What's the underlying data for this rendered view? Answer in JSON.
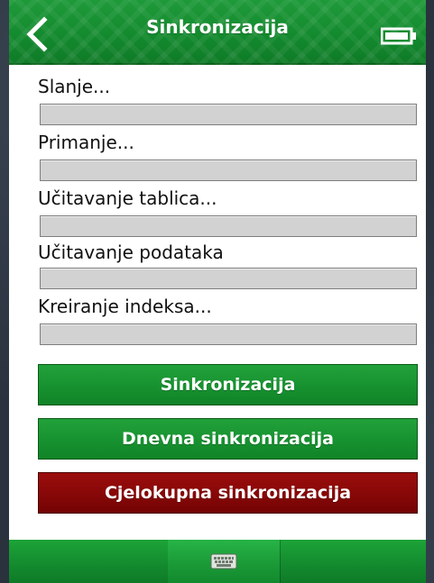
{
  "header": {
    "title": "Sinkronizacija",
    "back_icon": "chevron-left-icon",
    "battery_icon": "battery-icon"
  },
  "rows": [
    {
      "label": "Slanje...",
      "progress": 0
    },
    {
      "label": "Primanje...",
      "progress": 0
    },
    {
      "label": "Učitavanje tablica...",
      "progress": 0
    },
    {
      "label": "Učitavanje podataka",
      "progress": 0
    },
    {
      "label": "Kreiranje indeksa...",
      "progress": 0
    }
  ],
  "buttons": {
    "sync": "Sinkronizacija",
    "daily_sync": "Dnevna sinkronizacija",
    "full_sync": "Cjelokupna sinkronizacija"
  },
  "footer": {
    "keyboard_icon": "keyboard-icon"
  },
  "colors": {
    "accent_green": "#16902f",
    "danger_red": "#850707",
    "progress_bg": "#d2d2d2"
  }
}
